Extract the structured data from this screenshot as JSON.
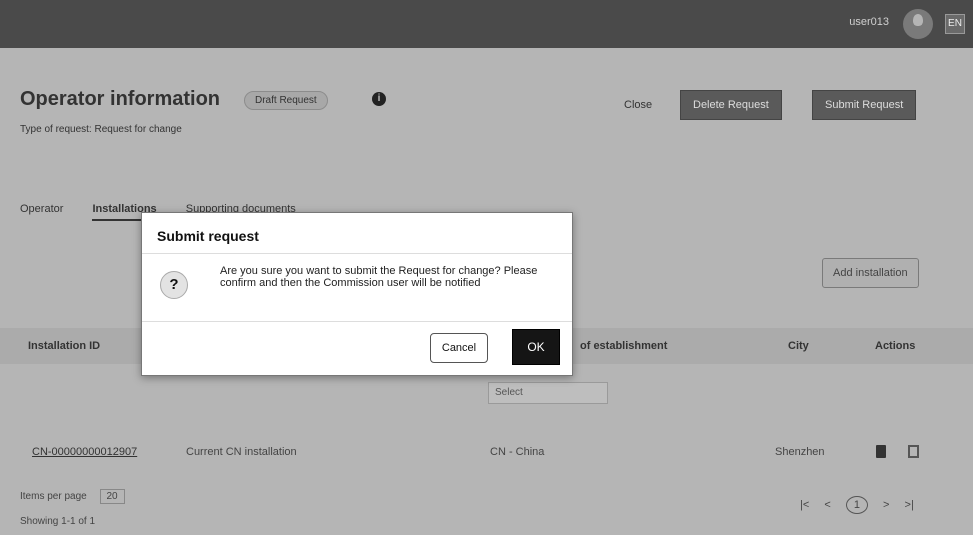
{
  "header": {
    "user_name": "user013",
    "language": "EN"
  },
  "page": {
    "title": "Operator information",
    "status": "Draft Request",
    "info_icon": "info-icon",
    "subtitle": "Type of request: Request for change",
    "close_label": "Close",
    "delete_label": "Delete Request",
    "submit_label": "Submit Request"
  },
  "tabs": [
    {
      "label": "Operator",
      "active": false
    },
    {
      "label": "Installations",
      "active": true
    },
    {
      "label": "Supporting documents",
      "active": false
    }
  ],
  "add_installation_label": "Add installation",
  "table": {
    "columns": {
      "installation_id": "Installation ID",
      "establishment": "of establishment",
      "city": "City",
      "actions": "Actions"
    },
    "filter_country": "Select",
    "rows": [
      {
        "installation_id": "CN-00000000012907",
        "name": "Current CN installation",
        "country": "CN - China",
        "city": "Shenzhen"
      }
    ]
  },
  "footer": {
    "items_per_page_label": "Items per page",
    "items_per_page_value": "20",
    "showing": "Showing 1-1 of 1",
    "current_page": "1"
  },
  "modal": {
    "title": "Submit request",
    "icon": "question-icon",
    "message": "Are you sure you want to submit the Request for change? Please confirm and then the Commission user will be notified",
    "cancel_label": "Cancel",
    "ok_label": "OK"
  }
}
